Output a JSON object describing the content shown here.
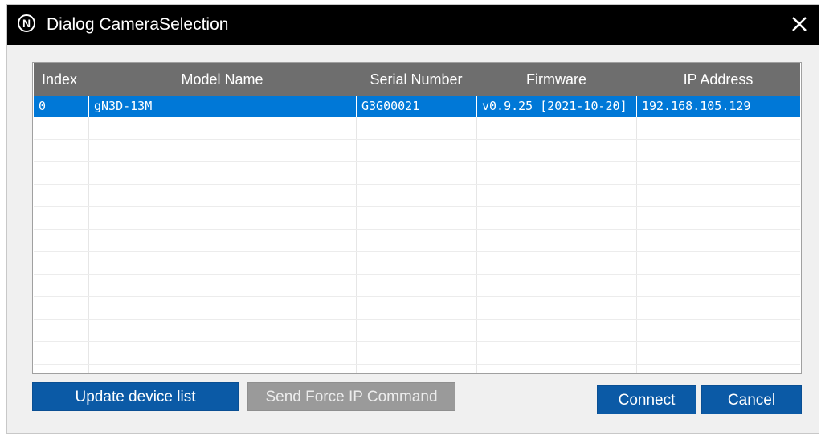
{
  "window": {
    "title": "Dialog CameraSelection",
    "icon_glyph": "N",
    "icon": "n-circle-icon",
    "close_icon": "close-icon"
  },
  "table": {
    "columns": [
      "Index",
      "Model Name",
      "Serial Number",
      "Firmware",
      "IP Address"
    ],
    "rows": [
      {
        "index": "0",
        "model": "gN3D-13M",
        "serial": "G3G00021",
        "firmware": "v0.9.25 [2021-10-20]",
        "ip": "192.168.105.129",
        "selected": true
      }
    ]
  },
  "buttons": {
    "update": "Update device list",
    "force_ip": "Send Force IP Command",
    "connect": "Connect",
    "cancel": "Cancel"
  },
  "colors": {
    "title_bar": "#000000",
    "selection": "#0078d7",
    "header": "#6e6e6e",
    "button_primary": "#0b5aa6",
    "button_disabled": "#9a9a9a"
  }
}
